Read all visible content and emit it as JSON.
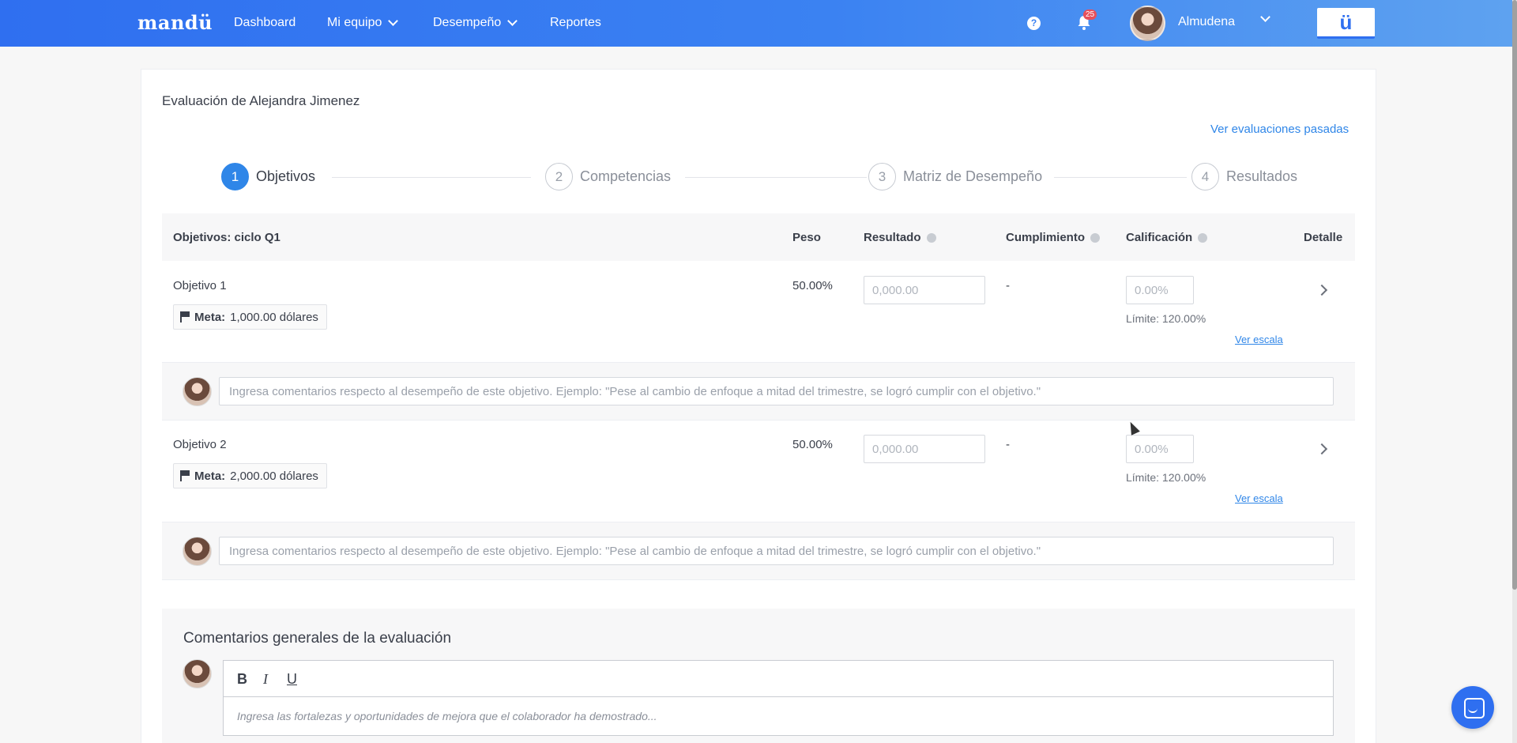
{
  "nav": {
    "logo": "mandü",
    "items": [
      {
        "label": "Dashboard",
        "dropdown": false
      },
      {
        "label": "Mi equipo",
        "dropdown": true
      },
      {
        "label": "Desempeño",
        "dropdown": true
      },
      {
        "label": "Reportes",
        "dropdown": false
      }
    ],
    "help_icon": "question-circle-icon",
    "notifications_count": "25",
    "user_name": "Almudena",
    "brand_button": "ü",
    "accent": "#2f6ff0"
  },
  "page": {
    "title": "Evaluación de Alejandra Jimenez",
    "past_link": "Ver evaluaciones pasadas"
  },
  "steps": [
    {
      "num": "1",
      "label": "Objetivos",
      "active": true
    },
    {
      "num": "2",
      "label": "Competencias",
      "active": false
    },
    {
      "num": "3",
      "label": "Matriz de Desempeño",
      "active": false
    },
    {
      "num": "4",
      "label": "Resultados",
      "active": false
    }
  ],
  "table": {
    "headers": {
      "objetivos": "Objetivos: ciclo Q1",
      "peso": "Peso",
      "resultado": "Resultado",
      "cumplimiento": "Cumplimiento",
      "calificacion": "Calificación",
      "detalle": "Detalle"
    },
    "rows": [
      {
        "name": "Objetivo 1",
        "meta_label": "Meta:",
        "meta_value": "1,000.00 dólares",
        "peso": "50.00%",
        "resultado_placeholder": "0,000.00",
        "cumplimiento": "-",
        "calificacion_placeholder": "0.00%",
        "limite": "Límite: 120.00%",
        "scale_link": "Ver escala",
        "comment_placeholder": "Ingresa comentarios respecto al desempeño de este objetivo. Ejemplo: \"Pese al cambio de enfoque a mitad del trimestre, se logró cumplir con el objetivo.\""
      },
      {
        "name": "Objetivo 2",
        "meta_label": "Meta:",
        "meta_value": "2,000.00 dólares",
        "peso": "50.00%",
        "resultado_placeholder": "0,000.00",
        "cumplimiento": "-",
        "calificacion_placeholder": "0.00%",
        "limite": "Límite: 120.00%",
        "scale_link": "Ver escala",
        "comment_placeholder": "Ingresa comentarios respecto al desempeño de este objetivo. Ejemplo: \"Pese al cambio de enfoque a mitad del trimestre, se logró cumplir con el objetivo.\""
      }
    ]
  },
  "general": {
    "title": "Comentarios generales de la evaluación",
    "toolbar": {
      "bold": "B",
      "italic": "I",
      "underline": "U"
    },
    "placeholder": "Ingresa las fortalezas y oportunidades de mejora que el colaborador ha demostrado..."
  }
}
